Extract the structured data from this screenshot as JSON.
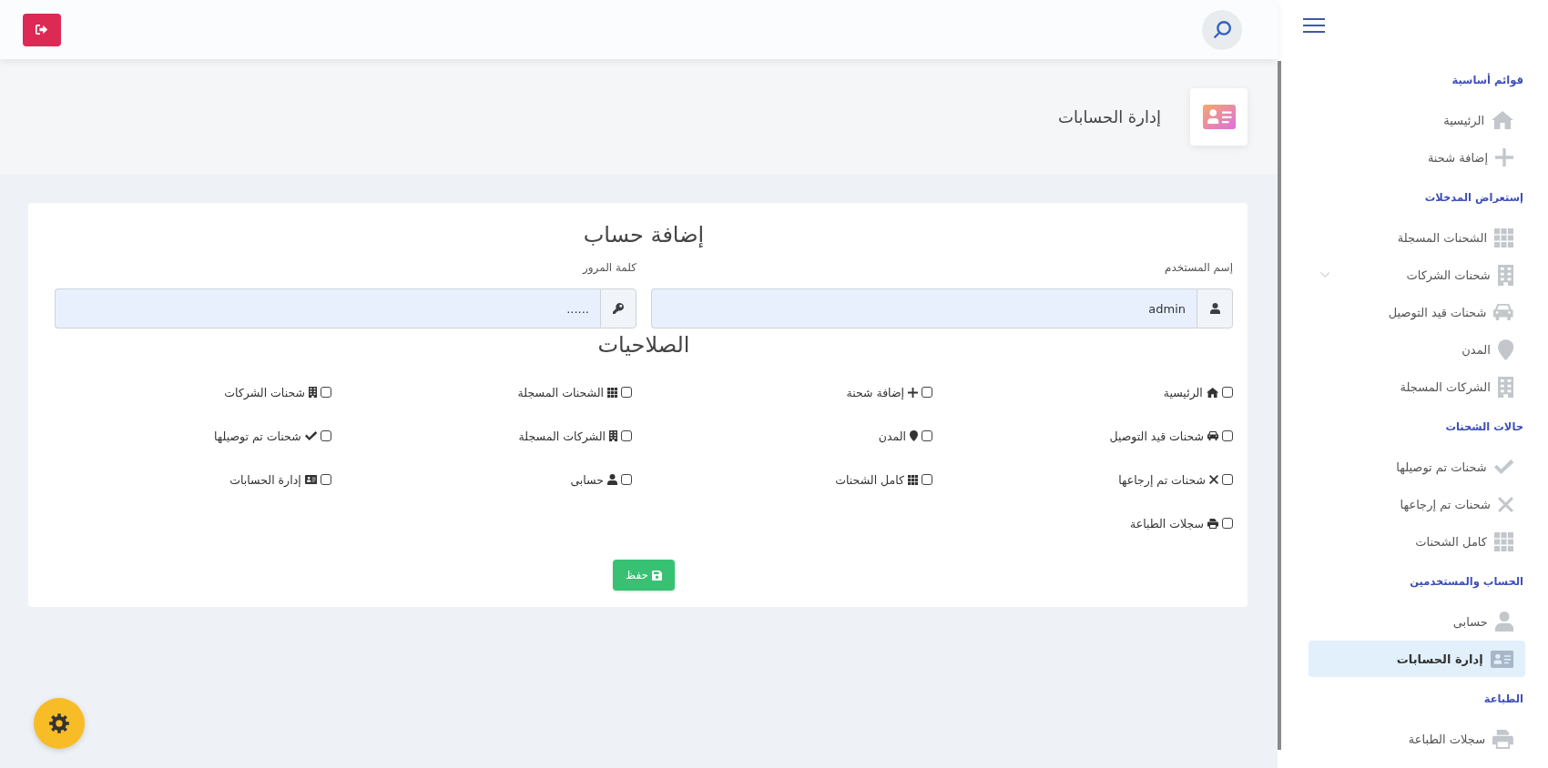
{
  "sidebar": {
    "sections": [
      {
        "title": "قوائم أساسية",
        "items": [
          {
            "label": "الرئيسية",
            "kind": "link",
            "selected": false
          },
          {
            "label": "إضافة شحنة",
            "kind": "link",
            "selected": false
          }
        ]
      },
      {
        "title": "إستعراض المدخلات",
        "items": [
          {
            "label": "الشحنات المسجلة",
            "kind": "link",
            "selected": false
          },
          {
            "label": "شحنات الشركات",
            "kind": "dropdown",
            "selected": false
          },
          {
            "label": "شحنات قيد التوصيل",
            "kind": "link",
            "selected": false
          },
          {
            "label": "المدن",
            "kind": "link",
            "selected": false
          },
          {
            "label": "الشركات المسجلة",
            "kind": "link",
            "selected": false
          }
        ]
      },
      {
        "title": "حالات الشحنات",
        "items": [
          {
            "label": "شحنات تم توصيلها",
            "kind": "link",
            "selected": false
          },
          {
            "label": "شحنات تم إرجاعها",
            "kind": "link",
            "selected": false
          },
          {
            "label": "كامل الشحنات",
            "kind": "link",
            "selected": false
          }
        ]
      },
      {
        "title": "الحساب والمستخدمين",
        "items": [
          {
            "label": "حسابى",
            "kind": "link",
            "selected": false
          },
          {
            "label": "إدارة الحسابات",
            "kind": "link",
            "selected": true
          }
        ]
      },
      {
        "title": "الطباعة",
        "items": [
          {
            "label": "سجلات الطباعة",
            "kind": "link",
            "selected": false
          }
        ]
      }
    ]
  },
  "page_header": {
    "title": "إدارة الحسابات"
  },
  "form": {
    "title": "إضافة حساب",
    "fields": [
      {
        "label": "إسم المستخدم",
        "value": "admin"
      },
      {
        "label": "كلمة المرور",
        "value": "......"
      }
    ]
  },
  "permissions": {
    "title": "الصلاحيات",
    "items": [
      {
        "label": "الرئيسية",
        "checked": false
      },
      {
        "label": "إضافة شحنة",
        "checked": false
      },
      {
        "label": "الشحنات المسجلة",
        "checked": false
      },
      {
        "label": "شحنات الشركات",
        "checked": false
      },
      {
        "label": "شحنات قيد التوصيل",
        "checked": false
      },
      {
        "label": "المدن",
        "checked": false
      },
      {
        "label": "الشركات المسجلة",
        "checked": false
      },
      {
        "label": "شحنات تم توصيلها",
        "checked": false
      },
      {
        "label": "شحنات تم إرجاعها",
        "checked": false
      },
      {
        "label": "كامل الشحنات",
        "checked": false
      },
      {
        "label": "حسابى",
        "checked": false
      },
      {
        "label": "إدارة الحسابات",
        "checked": false
      },
      {
        "label": "سجلات الطباعة",
        "checked": false
      }
    ]
  },
  "save_button": {
    "label": "حفظ"
  }
}
